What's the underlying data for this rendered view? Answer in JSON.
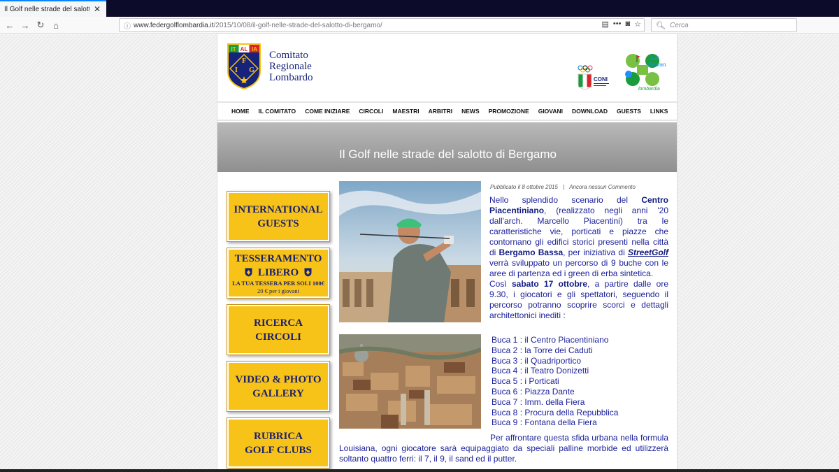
{
  "browser": {
    "tab_title": "Il Golf nelle strade del salotto di Bergamo",
    "url_host": "www.federgolflombardia.it",
    "url_path": "/2015/10/08/il-golf-nelle-strade-del-salotto-di-bergamo/",
    "search_placeholder": "Cerca",
    "icons": [
      "back-icon",
      "forward-icon",
      "reload-icon",
      "home-icon",
      "info-icon",
      "reader-icon",
      "more-icon",
      "pocket-icon",
      "bookmark-star-icon",
      "search-icon",
      "close-icon"
    ]
  },
  "header": {
    "shield_letters": {
      "top": [
        "IT",
        "AL",
        "IA"
      ],
      "f": "F",
      "i": "I",
      "g": "G"
    },
    "org_line1": "Comitato",
    "org_line2": "Regionale",
    "org_line3": "Lombardo",
    "coni_text": "CONI",
    "gg_line1": "Golf",
    "gg_line2": "Giovani",
    "gg_line3": "lombardia"
  },
  "nav": [
    "HOME",
    "IL COMITATO",
    "COME INIZIARE",
    "CIRCOLI",
    "MAESTRI",
    "ARBITRI",
    "NEWS",
    "PROMOZIONE",
    "GIOVANI",
    "DOWNLOAD",
    "GUESTS",
    "LINKS"
  ],
  "page_title": "Il Golf nelle strade del salotto di Bergamo",
  "sidebar": {
    "international_1": "INTERNATIONAL",
    "international_2": "GUESTS",
    "tess_1": "TESSERAMENTO",
    "tess_2": "LIBERO",
    "tess_3": "LA TUA TESSERA PER SOLI 100€",
    "tess_4": "20 € per i giovani",
    "ricerca_1": "RICERCA",
    "ricerca_2": "CIRCOLI",
    "video_1": "VIDEO & PHOTO",
    "video_2": "GALLERY",
    "rubrica_1": "RUBRICA",
    "rubrica_2": "GOLF CLUBS"
  },
  "article": {
    "meta_date": "Pubblicato il 8 ottobre 2015",
    "meta_sep": "|",
    "meta_comments": "Ancora nessun Commento",
    "p1_a": "Nello splendido scenario del ",
    "p1_b": "Centro Piacentiniano",
    "p1_c": ", (realizzato negli anni '20 dall'arch. Marcello Piacentini) tra le caratteristiche vie, porticati e piazze che contornano gli edifici storici presenti nella città di ",
    "p1_d": "Bergamo Bassa",
    "p1_e": ", per iniziativa di ",
    "p1_f": "StreetGolf",
    "p1_g": " verrà sviluppato un percorso di 9 buche con le aree di partenza ed i green di erba sintetica.",
    "p2_a": "Così ",
    "p2_b": "sabato 17 ottobre",
    "p2_c": ", a partire dalle ore 9.30, i giocatori e gli spettatori, seguendo il percorso potranno scoprire scorci e dettagli architettonici inediti :",
    "holes": [
      "Buca 1 : il Centro Piacentiniano",
      "Buca 2 : la Torre dei Caduti",
      "Buca 3 : il Quadriportico",
      "Buca 4 : il Teatro Donizetti",
      "Buca 5 : i Porticati",
      "Buca 6 : Piazza Dante",
      "Buca 7 : Imm. della Fiera",
      "Buca 8 : Procura della Repubblica",
      "Buca 9 : Fontana della Fiera"
    ],
    "closing": "Per affrontare questa sfida urbana nella formula Louisiana, ogni giocatore sarà equipaggiato da speciali palline morbide ed utilizzerà soltanto quattro ferri: il 7, il 9, il sand ed il putter."
  },
  "colors": {
    "accent_yellow": "#f7c318",
    "text_blue": "#1a1f9a",
    "nav_text": "#111111",
    "title_band": "#a5a5a5"
  }
}
